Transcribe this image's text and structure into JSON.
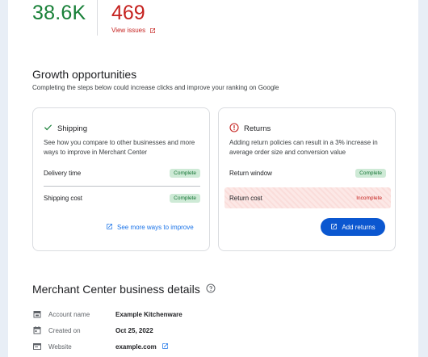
{
  "stats": {
    "clicks_value": "38.6K",
    "issues_value": "469",
    "view_issues_label": "View issues"
  },
  "growth": {
    "title": "Growth opportunities",
    "subtitle": "Completing the steps below could increase clicks and improve your ranking on Google",
    "shipping": {
      "title": "Shipping",
      "description": "See how you compare to other businesses and more ways to improve in Merchant Center",
      "rows": [
        {
          "label": "Delivery time",
          "status": "Complete"
        },
        {
          "label": "Shipping cost",
          "status": "Complete"
        }
      ],
      "link_label": "See more ways to improve"
    },
    "returns": {
      "title": "Returns",
      "description": "Adding return policies can result in a 3% increase in average order size and conversion value",
      "rows": [
        {
          "label": "Return window",
          "status": "Complete"
        },
        {
          "label": "Return cost",
          "status": "Incomplete"
        }
      ],
      "button_label": "Add returns"
    }
  },
  "details": {
    "title": "Merchant Center business details",
    "rows": [
      {
        "icon": "storefront-icon",
        "label": "Account name",
        "value": "Example Kitchenware"
      },
      {
        "icon": "calendar-icon",
        "label": "Created on",
        "value": "Oct 25, 2022"
      },
      {
        "icon": "web-icon",
        "label": "Website",
        "value": "example.com"
      }
    ]
  },
  "colors": {
    "positive": "#188038",
    "negative": "#c5221f",
    "link": "#1a73e8",
    "primary_button": "#0b57d0",
    "complete_badge_bg": "#ceead6",
    "incomplete_row_bg": "#fce8e6"
  }
}
